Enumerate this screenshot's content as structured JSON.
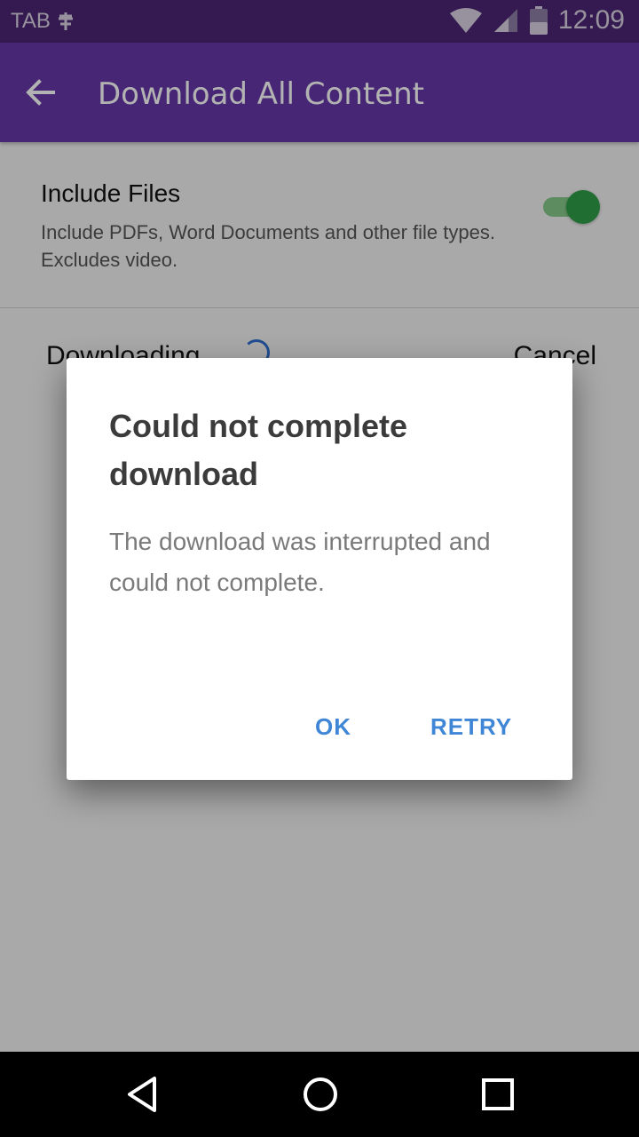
{
  "status_bar": {
    "left_text": "TAB",
    "time": "12:09",
    "icons": [
      "signal-icon",
      "wifi-icon",
      "cell-signal-icon",
      "battery-icon"
    ]
  },
  "app_bar": {
    "title": "Download All Content",
    "back_icon": "arrow-back-icon",
    "color": "#6638a8"
  },
  "settings": {
    "include_files": {
      "title": "Include Files",
      "description": "Include PDFs, Word Documents and other file types. Excludes video.",
      "enabled": true,
      "toggle_color": "#2e9e47"
    }
  },
  "download": {
    "label": "Downloading",
    "cancel_label": "Cancel"
  },
  "dialog": {
    "title": "Could not complete download",
    "message": "The download was interrupted and could not complete.",
    "ok_label": "OK",
    "retry_label": "RETRY",
    "button_color": "#3f86d6"
  },
  "nav_bar": {
    "icons": [
      "back-triangle-icon",
      "home-circle-icon",
      "recents-square-icon"
    ]
  }
}
